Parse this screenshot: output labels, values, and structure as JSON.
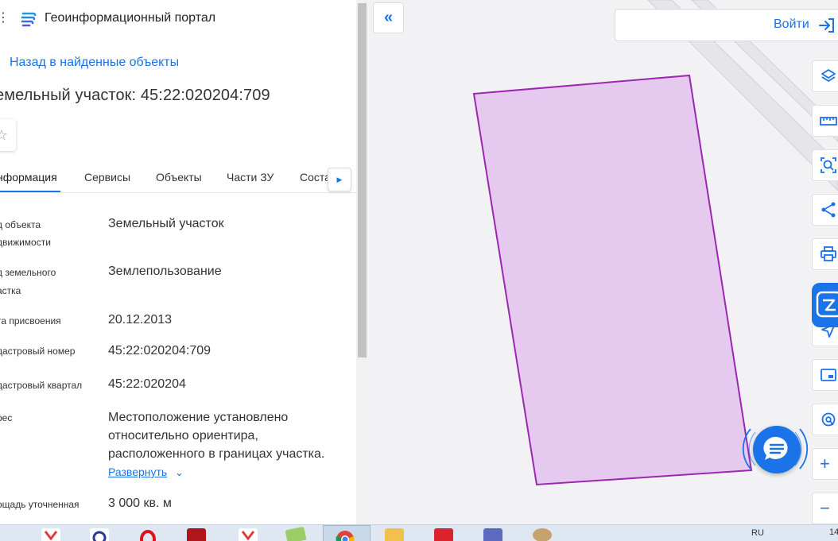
{
  "app": {
    "title": "Геоинформационный портал",
    "menu_glyph": "⋮",
    "logo_icon": "portal-logo-icon"
  },
  "panel": {
    "back_link": "Назад в найденные объекты",
    "object_title": "емельный участок: 45:22:020204:709",
    "favorite_icon": "star-outline-icon",
    "tabs": [
      {
        "label": "нформация",
        "active": true
      },
      {
        "label": "Сервисы",
        "active": false
      },
      {
        "label": "Объекты",
        "active": false
      },
      {
        "label": "Части ЗУ",
        "active": false
      },
      {
        "label": "Соста",
        "active": false
      }
    ],
    "tabs_next_glyph": "▶",
    "properties": [
      {
        "label_lines": [
          "д объекта",
          "движимости"
        ],
        "value_lines": [
          "Земельный участок"
        ]
      },
      {
        "label_lines": [
          "д земельного",
          "астка"
        ],
        "value_lines": [
          "Землепользование"
        ]
      },
      {
        "label_lines": [
          "та присвоения"
        ],
        "value_lines": [
          "20.12.2013"
        ]
      },
      {
        "label_lines": [
          "дастровый номер"
        ],
        "value_lines": [
          "45:22:020204:709"
        ]
      },
      {
        "label_lines": [
          "дастровый квартал"
        ],
        "value_lines": [
          "45:22:020204"
        ]
      },
      {
        "label_lines": [
          "рес"
        ],
        "value_lines": [
          "Местоположение установлено",
          "относительно ориентира,",
          "расположенного в границах участка."
        ]
      },
      {
        "label_lines": [
          "ощадь уточненная"
        ],
        "value_lines": [
          "3 000 кв. м"
        ]
      }
    ],
    "expand_link": "Развернуть",
    "expand_chevron": "⌄"
  },
  "map": {
    "collapse_glyph": "«",
    "login_label": "Войти",
    "login_icon": "login-arrow-icon",
    "parcel_fill": "#e6c9ee",
    "parcel_stroke": "#9c27b0",
    "tools": [
      {
        "name": "layers-icon"
      },
      {
        "name": "ruler-icon"
      },
      {
        "name": "select-area-icon"
      },
      {
        "name": "share-icon"
      },
      {
        "name": "print-icon"
      },
      {
        "name": "navigation-icon"
      },
      {
        "name": "minimap-icon"
      },
      {
        "name": "location-icon"
      },
      {
        "name": "zoom-in-icon",
        "glyph": "+"
      },
      {
        "name": "zoom-out-icon",
        "glyph": "−"
      }
    ],
    "chat_icon": "chat-icon",
    "accent": "#1a73e8"
  },
  "taskbar": {
    "language": "RU",
    "time": "14"
  }
}
